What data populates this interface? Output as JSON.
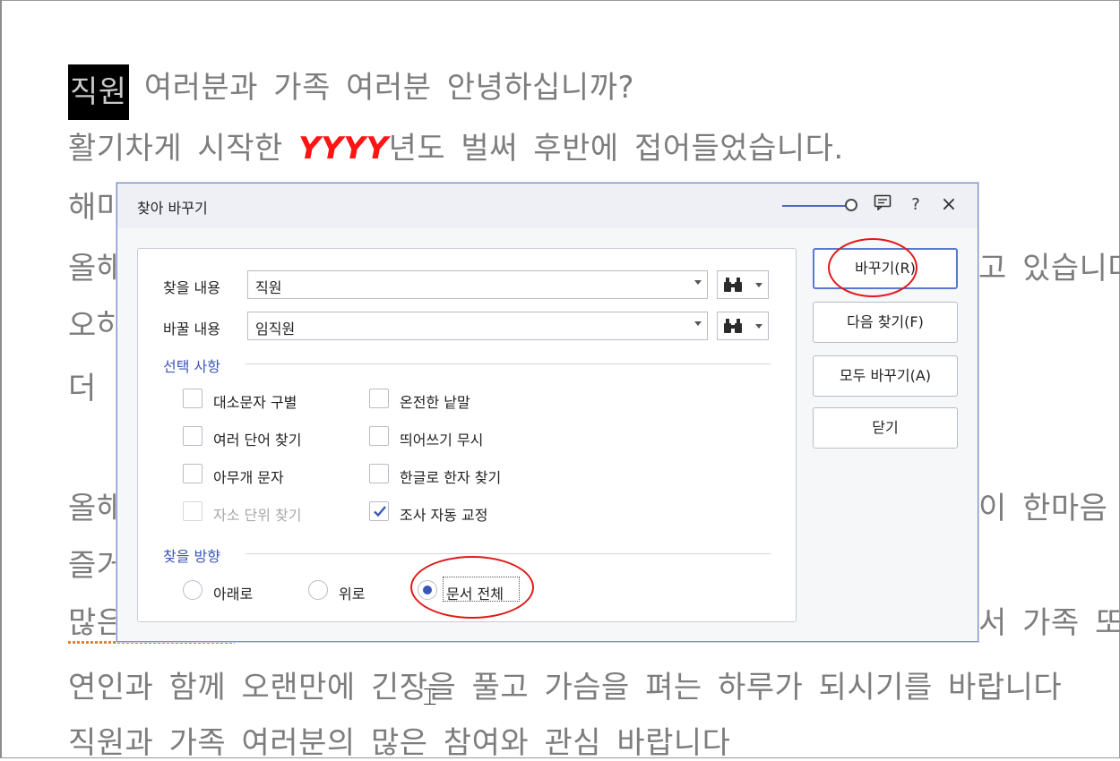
{
  "document": {
    "line1_selected": "직원",
    "line1_rest": " 여러분과 가족 여러분 안녕하십니까?",
    "line2_before": "활기차게 시작한 ",
    "line2_highlight": "YYYY",
    "line2_after": "년도 벌써 후반에 접어들었습니다.",
    "line3": "해마",
    "line4_left": "올해",
    "line4_right": "고 있습니다",
    "line5": "오하",
    "line6": "더",
    "line7_left": "올해",
    "line7_right": "이 한마음",
    "line8": "즐거",
    "line9_left": "많은",
    "line9_right": "서 가족 또",
    "line10": "연인과 함께 오랜만에 긴장을 풀고 가슴을 펴는 하루가 되시기를 바랍니다",
    "line11": "직원과 가족 여러분의 많은 참여와 관심 바랍니다"
  },
  "dialog": {
    "title": "찾아 바꾸기",
    "find_label": "찾을 내용",
    "find_value": "직원",
    "replace_label": "바꿀 내용",
    "replace_value": "임직원",
    "options_title": "선택 사항",
    "options": {
      "match_case": "대소문자 구별",
      "whole_word": "온전한 낱말",
      "multi_word": "여러 단어 찾기",
      "ignore_space": "띄어쓰기 무시",
      "wildcard": "아무개 문자",
      "hanja_by_hangul": "한글로 한자 찾기",
      "jamo_unit": "자소 단위 찾기",
      "auto_josa": "조사 자동 교정"
    },
    "direction_title": "찾을 방향",
    "direction": {
      "down": "아래로",
      "up": "위로",
      "whole": "문서 전체"
    },
    "buttons": {
      "replace": "바꾸기(R)",
      "find_next": "다음 찾기(F)",
      "replace_all": "모두 바꾸기(A)",
      "close": "닫기"
    },
    "titlebar_help": "?",
    "titlebar_close": "×"
  },
  "colors": {
    "accent": "#3a57b8",
    "annotation": "#e01a1a",
    "highlight_text": "#ff1414"
  },
  "icons": [
    "binoculars-icon",
    "note-icon",
    "help-icon",
    "close-icon",
    "chevron-down-icon",
    "checkmark-icon"
  ]
}
